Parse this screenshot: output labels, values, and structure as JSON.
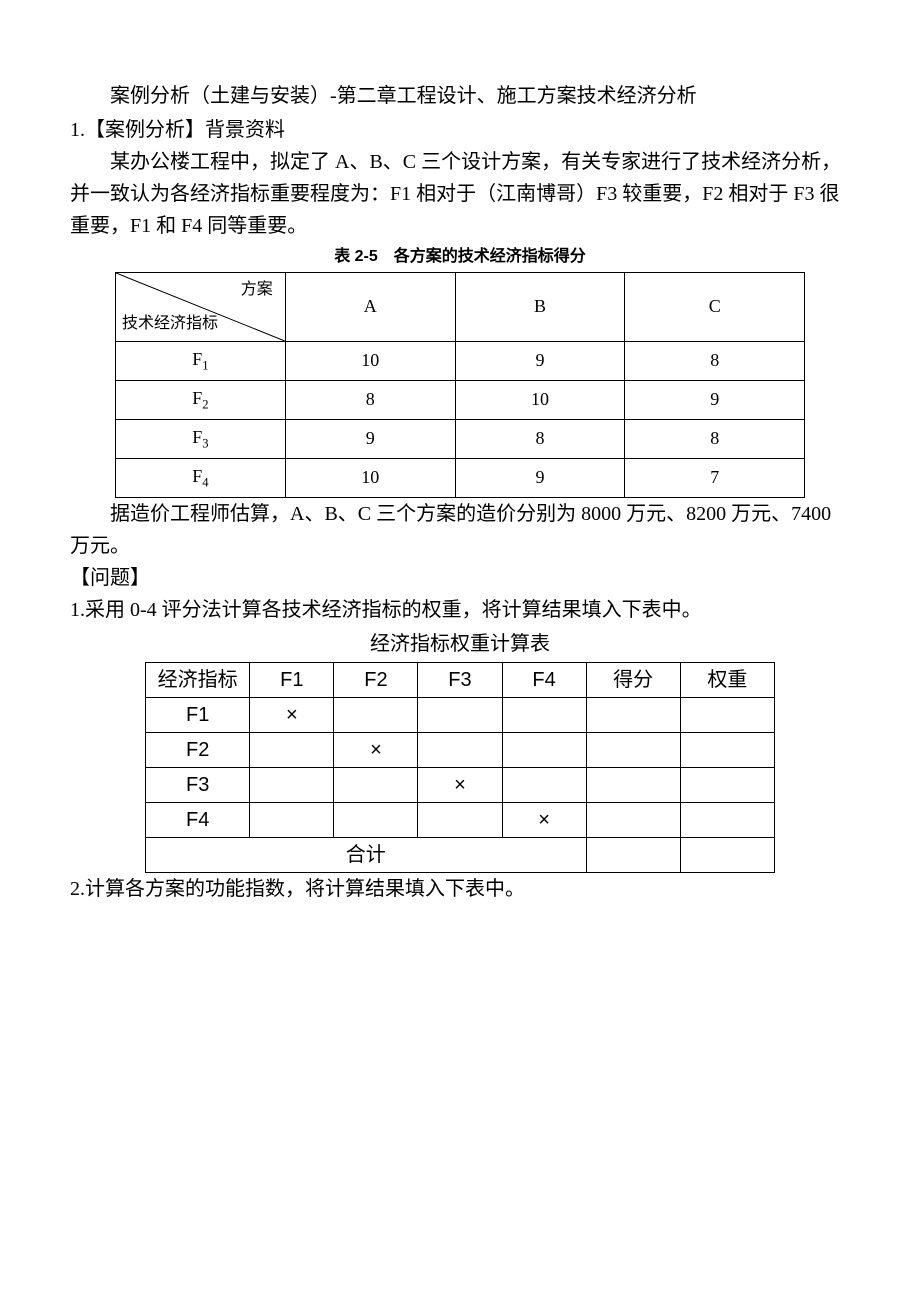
{
  "title": "案例分析（土建与安装）-第二章工程设计、施工方案技术经济分析",
  "section1": "1.【案例分析】背景资料",
  "para1": "某办公楼工程中，拟定了 A、B、C 三个设计方案，有关专家进行了技术经济分析，并一致认为各经济指标重要程度为：F1 相对于（江南博哥）F3 较重要，F2 相对于 F3 很重要，F1 和 F4 同等重要。",
  "table1_caption": "表 2-5　各方案的技术经济指标得分",
  "table1": {
    "diag_top": "方案",
    "diag_bottom": "技术经济指标",
    "cols": [
      "A",
      "B",
      "C"
    ],
    "rows": [
      {
        "label_base": "F",
        "label_sub": "1",
        "vals": [
          "10",
          "9",
          "8"
        ]
      },
      {
        "label_base": "F",
        "label_sub": "2",
        "vals": [
          "8",
          "10",
          "9"
        ]
      },
      {
        "label_base": "F",
        "label_sub": "3",
        "vals": [
          "9",
          "8",
          "8"
        ]
      },
      {
        "label_base": "F",
        "label_sub": "4",
        "vals": [
          "10",
          "9",
          "7"
        ]
      }
    ]
  },
  "para2": "据造价工程师估算，A、B、C 三个方案的造价分别为 8000 万元、8200 万元、7400 万元。",
  "question_hdr": "【问题】",
  "q1": "1.采用 0-4 评分法计算各技术经济指标的权重，将计算结果填入下表中。",
  "table2_caption": "经济指标权重计算表",
  "table2": {
    "headers": [
      "经济指标",
      "F1",
      "F2",
      "F3",
      "F4",
      "得分",
      "权重"
    ],
    "rows": [
      "F1",
      "F2",
      "F3",
      "F4"
    ],
    "mark": "×",
    "total": "合计"
  },
  "q2": "2.计算各方案的功能指数，将计算结果填入下表中。"
}
